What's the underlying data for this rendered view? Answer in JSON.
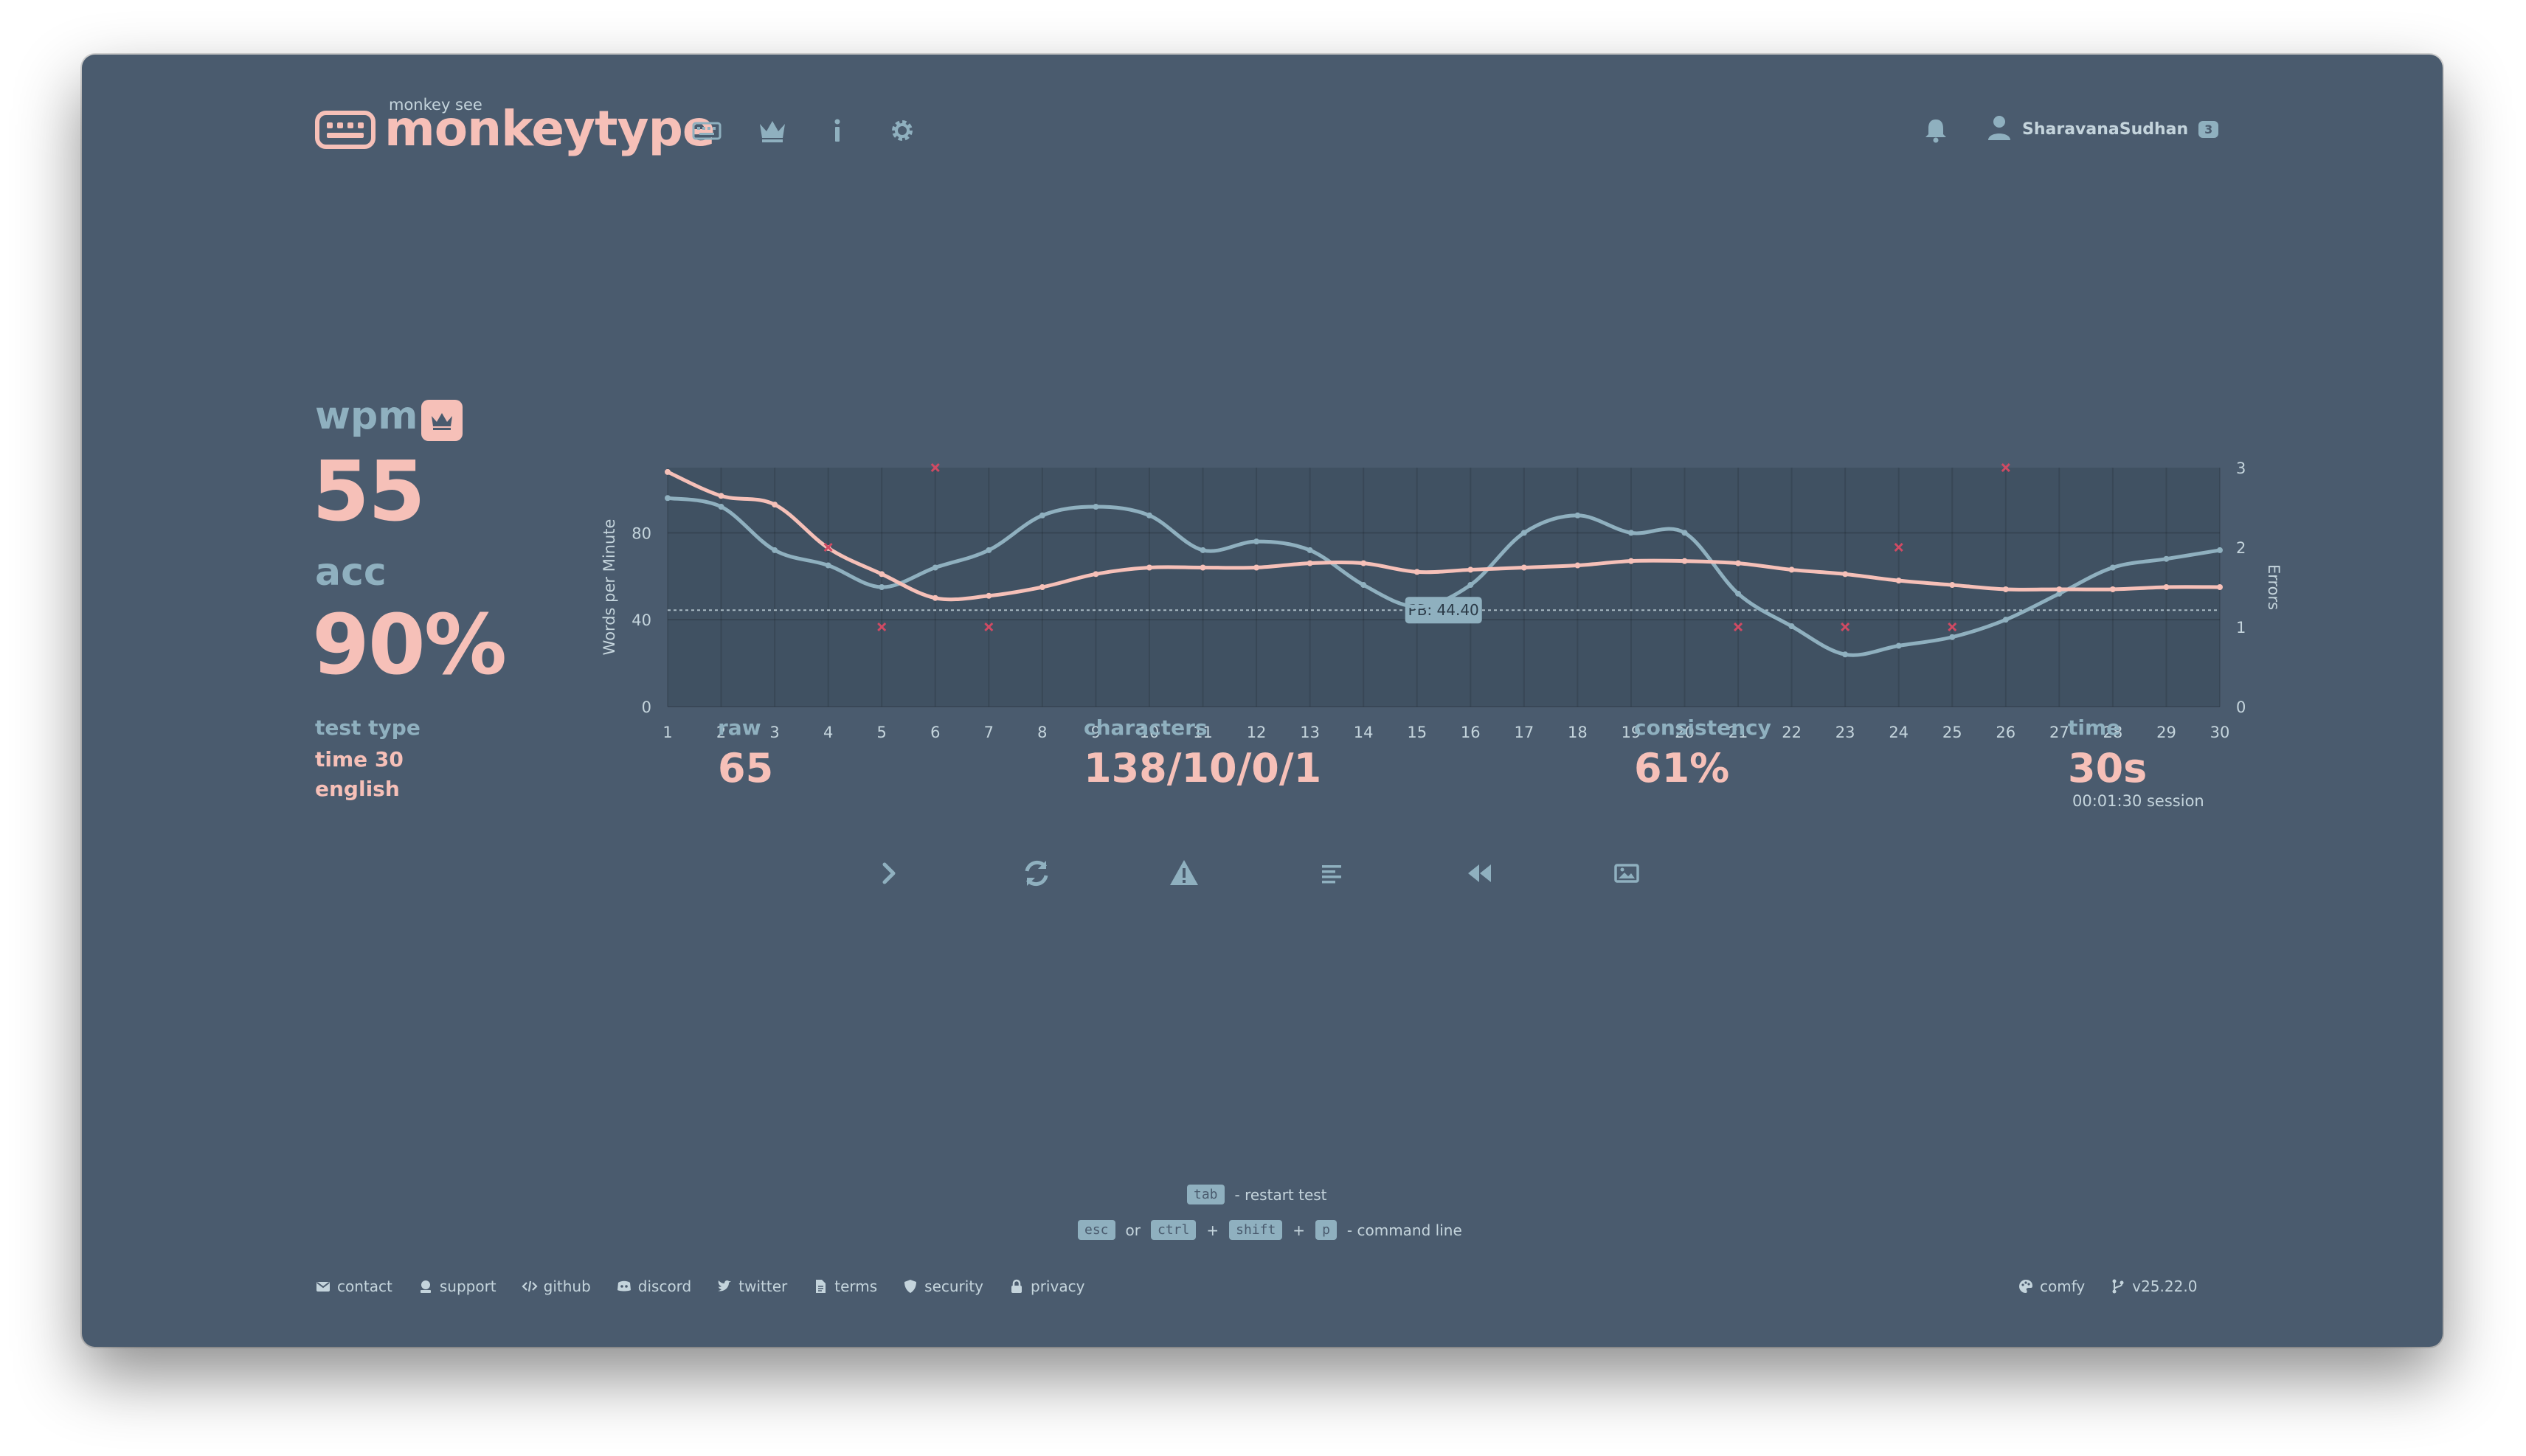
{
  "header": {
    "logo_subtitle": "monkey see",
    "logo_title": "monkeytype",
    "nav_icons": [
      "keyboard-icon",
      "crown-icon",
      "info-icon",
      "settings-icon"
    ],
    "username": "SharavanaSudhan",
    "user_badge": "3"
  },
  "result": {
    "wpm_label": "wpm",
    "wpm_value": "55",
    "acc_label": "acc",
    "acc_value": "90%"
  },
  "stats": {
    "test_type_label": "test type",
    "test_type_line1": "time 30",
    "test_type_line2": "english",
    "raw_label": "raw",
    "raw_value": "65",
    "characters_label": "characters",
    "characters_value": "138/10/0/1",
    "consistency_label": "consistency",
    "consistency_value": "61%",
    "time_label": "time",
    "time_value": "30s",
    "session": "00:01:30 session"
  },
  "chart_data": {
    "type": "line",
    "x": [
      1,
      2,
      3,
      4,
      5,
      6,
      7,
      8,
      9,
      10,
      11,
      12,
      13,
      14,
      15,
      16,
      17,
      18,
      19,
      20,
      21,
      22,
      23,
      24,
      25,
      26,
      27,
      28,
      29,
      30
    ],
    "ylabel": "Words per Minute",
    "y2label": "Errors",
    "ylim": [
      0,
      110
    ],
    "y2lim": [
      0,
      3
    ],
    "yticks": [
      0,
      40,
      80
    ],
    "y2ticks": [
      0,
      1,
      2,
      3
    ],
    "pb_label": "PB: 44.40",
    "pb_value": 44.4,
    "series": [
      {
        "values": [
          108,
          97,
          93,
          73,
          61,
          50,
          51,
          55,
          61,
          64,
          64,
          64,
          66,
          66,
          62,
          63,
          64,
          65,
          67,
          67,
          66,
          63,
          61,
          58,
          56,
          54,
          54,
          54,
          55,
          55
        ],
        "color": "#f6c0b8"
      },
      {
        "values": [
          96,
          92,
          72,
          65,
          55,
          64,
          72,
          88,
          92,
          88,
          72,
          76,
          72,
          56,
          46,
          56,
          80,
          88,
          80,
          80,
          52,
          37,
          24,
          28,
          32,
          40,
          52,
          64,
          68,
          72
        ],
        "color": "#8fb0bf"
      }
    ],
    "errors": [
      {
        "x": 4,
        "y": 2
      },
      {
        "x": 5,
        "y": 1
      },
      {
        "x": 6,
        "y": 3
      },
      {
        "x": 7,
        "y": 1
      },
      {
        "x": 21,
        "y": 1
      },
      {
        "x": 23,
        "y": 1
      },
      {
        "x": 24,
        "y": 2
      },
      {
        "x": 25,
        "y": 1
      },
      {
        "x": 26,
        "y": 3
      }
    ],
    "grid": true
  },
  "actions": [
    "next-test-icon",
    "restart-icon",
    "report-icon",
    "words-history-icon",
    "replay-icon",
    "screenshot-icon"
  ],
  "hints": {
    "tab_key": "tab",
    "restart_text": "- restart test",
    "esc_key": "esc",
    "or_text": "or",
    "ctrl_key": "ctrl",
    "plus1": "+",
    "shift_key": "shift",
    "plus2": "+",
    "p_key": "p",
    "command_text": "- command line"
  },
  "footer": {
    "contact": "contact",
    "support": "support",
    "github": "github",
    "discord": "discord",
    "twitter": "twitter",
    "terms": "terms",
    "security": "security",
    "privacy": "privacy",
    "theme": "comfy",
    "version": "v25.22.0"
  },
  "colors": {
    "background": "#4a5b6e",
    "main": "#8fb0bf",
    "accent": "#f6c0b8",
    "text": "#c4d4dc",
    "error": "#d04a63"
  }
}
